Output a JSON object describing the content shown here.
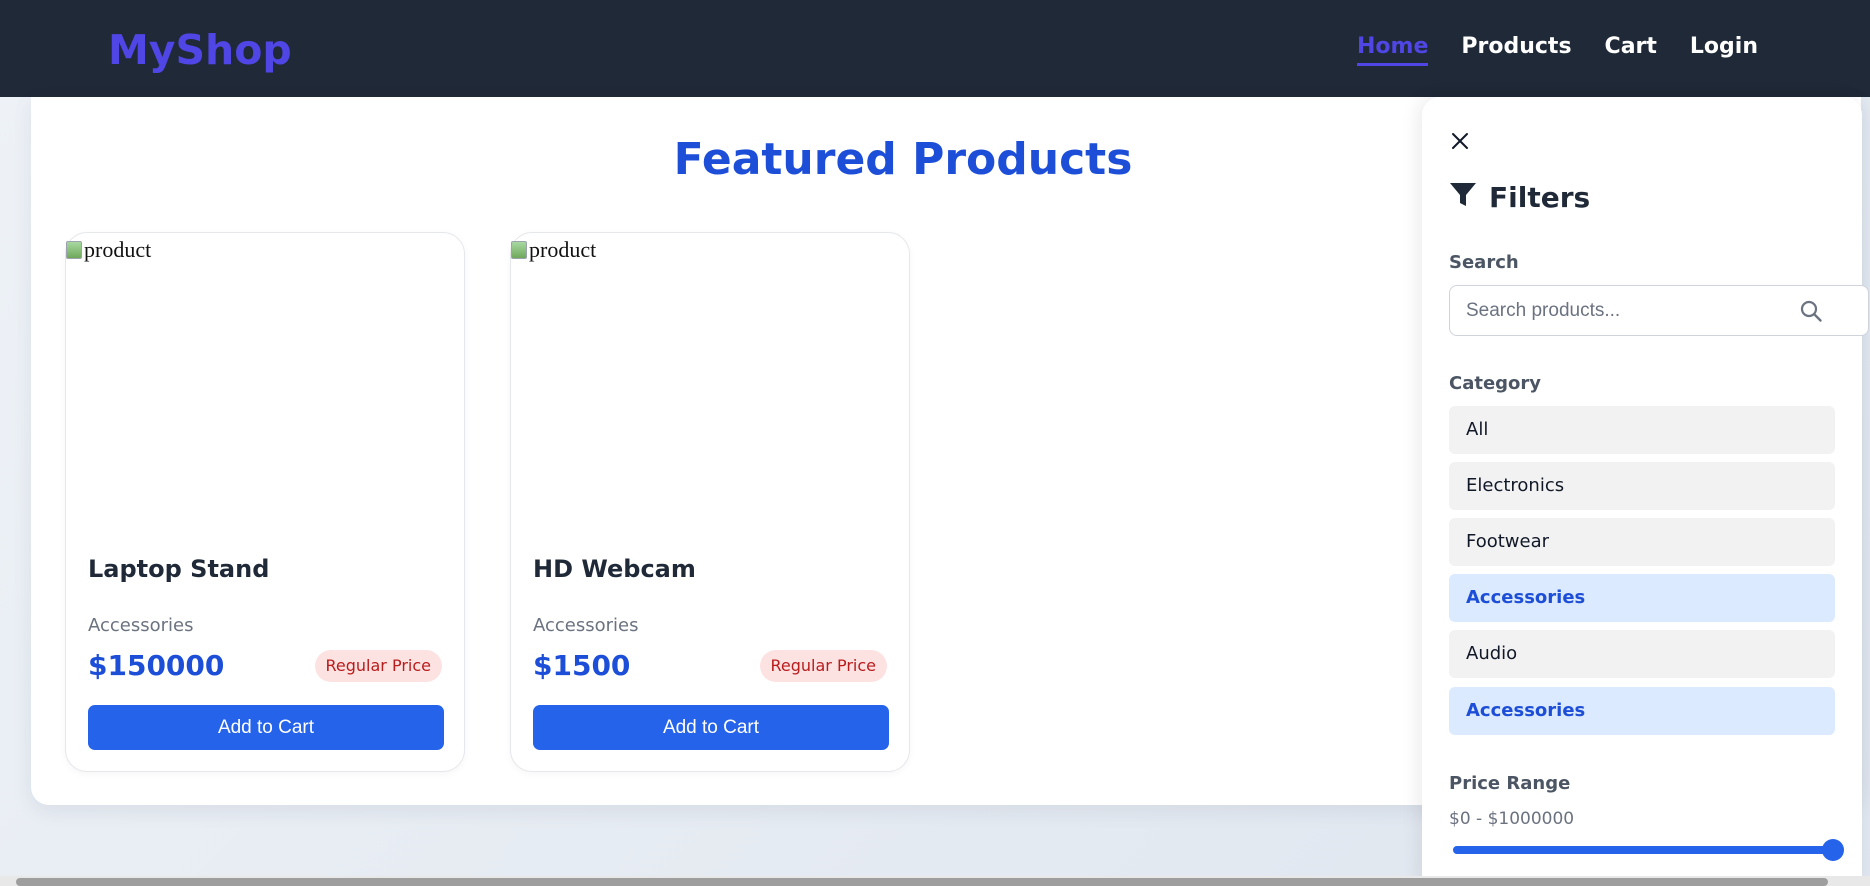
{
  "nav": {
    "brand": "MyShop",
    "links": [
      "Home",
      "Products",
      "Cart",
      "Login"
    ],
    "active": "Home"
  },
  "main": {
    "title": "Featured Products",
    "products": [
      {
        "image_alt": "product",
        "name": "Laptop Stand",
        "category": "Accessories",
        "price": "$150000",
        "badge": "Regular Price",
        "button": "Add to Cart"
      },
      {
        "image_alt": "product",
        "name": "HD Webcam",
        "category": "Accessories",
        "price": "$1500",
        "badge": "Regular Price",
        "button": "Add to Cart"
      }
    ]
  },
  "filters": {
    "title": "Filters",
    "search_label": "Search",
    "search_placeholder": "Search products...",
    "search_value": "",
    "category_label": "Category",
    "categories": [
      {
        "label": "All",
        "selected": false
      },
      {
        "label": "Electronics",
        "selected": false
      },
      {
        "label": "Footwear",
        "selected": false
      },
      {
        "label": "Accessories",
        "selected": true
      },
      {
        "label": "Audio",
        "selected": false
      },
      {
        "label": "Accessories",
        "selected": true
      }
    ],
    "price_label": "Price Range",
    "price_range_text": "$0 - $1000000",
    "price_slider_value": 1.0
  },
  "icons": {
    "close": "close-icon",
    "filter": "filter-icon",
    "search": "search-icon"
  },
  "colors": {
    "accent": "#2563eb",
    "brand": "#4f46e5",
    "title": "#1d4ed8",
    "navbar_bg": "#1f2937",
    "badge_bg": "#fde2e2",
    "badge_text": "#b91c1c",
    "selected_bg": "#dbeafe"
  }
}
